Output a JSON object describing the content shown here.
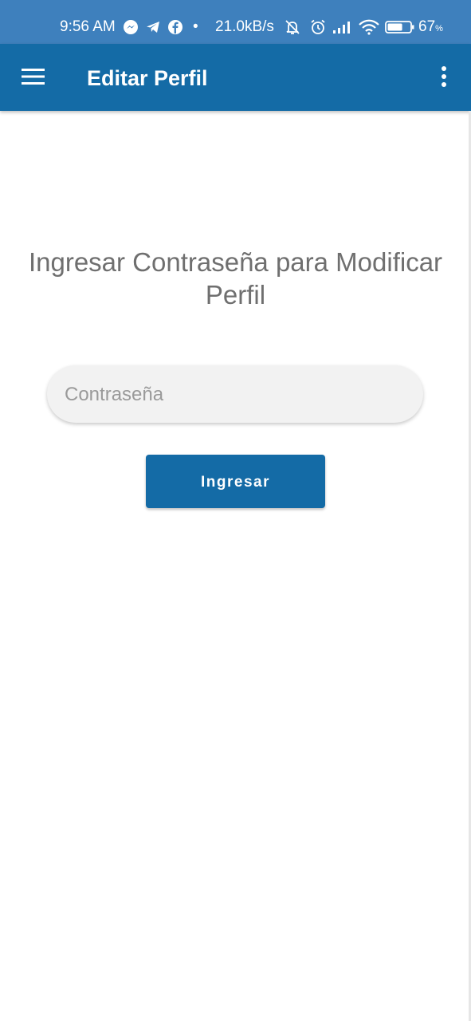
{
  "status_bar": {
    "time": "9:56 AM",
    "dot": "•",
    "network_speed": "21.0kB/s",
    "battery_percent": "67",
    "battery_unit": "%",
    "battery_level": 0.67,
    "icons": [
      "messenger-icon",
      "telegram-icon",
      "facebook-icon",
      "bell-muted-icon",
      "alarm-icon",
      "signal-icon",
      "wifi-icon",
      "battery-icon"
    ]
  },
  "app_bar": {
    "title": "Editar Perfil",
    "background": "#146BA6",
    "icons": [
      "menu-icon",
      "more-vert-icon"
    ]
  },
  "main": {
    "heading": "Ingresar Contraseña para Modificar Perfil",
    "password_input": {
      "value": "",
      "placeholder": "Contraseña"
    },
    "submit_label": "Ingresar"
  },
  "colors": {
    "status_bar": "#3E80BD",
    "primary": "#146BA6",
    "heading_text": "#6F6F6F",
    "input_background": "#F2F2F2"
  }
}
